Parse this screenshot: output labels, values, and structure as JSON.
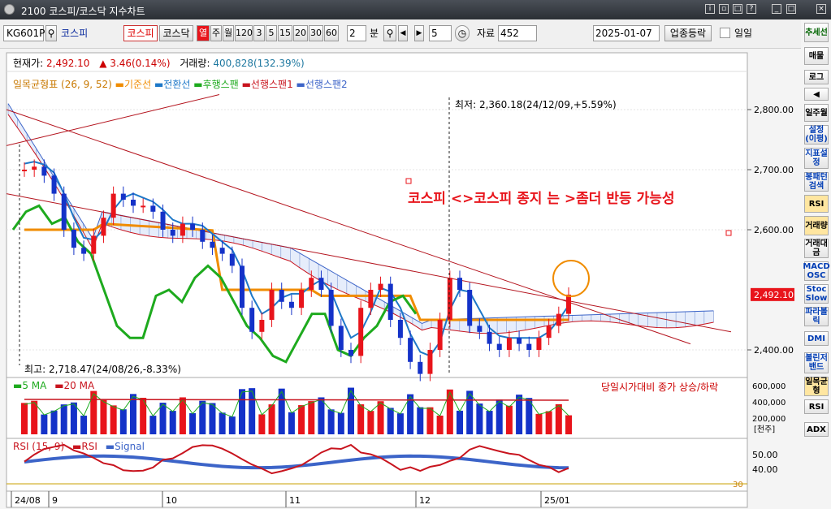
{
  "window": {
    "title": "2100 코스피/코스닥 지수차트"
  },
  "toolbar": {
    "code": "KG601P",
    "code_name": "코스피",
    "market_kospi": "코스피",
    "market_kosdaq": "코스닥",
    "periods": [
      "열",
      "주",
      "월",
      "120",
      "3",
      "5",
      "15",
      "20",
      "30",
      "60"
    ],
    "interval_value": "2",
    "interval_unit": "분",
    "nav_value": "5",
    "data_label": "자료",
    "data_count": "452",
    "date": "2025-01-07",
    "sector_btn": "업종등락",
    "daily_label": "일일"
  },
  "info": {
    "price_label": "현재가:",
    "price": "2,492.10",
    "change": "▲ 3.46(0.14%)",
    "volume_label": "거래량:",
    "volume": "400,828(132.39%)"
  },
  "legend": {
    "ichimoku": "일목균형표 (26, 9, 52)",
    "base": "기준선",
    "conversion": "전환선",
    "lagging": "후행스팬",
    "lead1": "선행스팬1",
    "lead2": "선행스팬2"
  },
  "annotations": {
    "low": "최저: 2,360.18(24/12/09,+5.59%)",
    "high": "최고: 2,718.47(24/08/26,-8.33%)",
    "comment": "코스피 <>코스피 종지 는 >좀더 반등 가능성"
  },
  "price_axis": {
    "ticks": [
      "2,800.00",
      "2,700.00",
      "2,600.00",
      "2,400.00"
    ],
    "current": "2,492.10"
  },
  "volume_panel": {
    "ma5": "5 MA",
    "ma20": "20 MA",
    "right_note": "당일시가대비 종가 상승/하락",
    "ticks": [
      "600,000",
      "400,000",
      "200,000"
    ],
    "unit": "[천주]"
  },
  "rsi_panel": {
    "title": "RSI (15, 9)",
    "rsi": "RSI",
    "signal": "Signal",
    "ticks": [
      "50.00",
      "40.00"
    ],
    "level": "30"
  },
  "date_axis": [
    "24/08",
    "9",
    "10",
    "11",
    "12",
    "25/01"
  ],
  "sidebar": [
    "추세선",
    "매물",
    "로그",
    "◀",
    "일주월",
    "설정(이평)",
    "지표설정",
    "봉패턴검색",
    "RSI",
    "거래량",
    "거래대금",
    "MACD OSC",
    "Stoc Slow",
    "파라볼릭",
    "DMI",
    "볼린저밴드",
    "일목균형",
    "RSI",
    "ADX"
  ],
  "colors": {
    "up": "#e8141b",
    "down": "#1432c8",
    "base": "#f08c00",
    "conversion": "#1e78c8",
    "lagging": "#1eaa1e",
    "lead1": "#c8141e",
    "lead2": "#3c64c8"
  }
}
